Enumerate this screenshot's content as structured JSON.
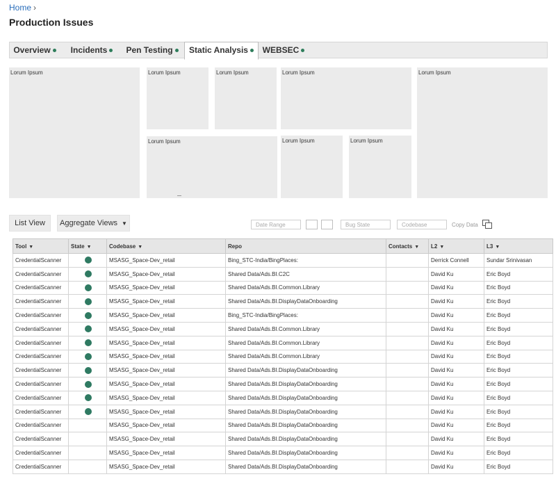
{
  "breadcrumb": {
    "home": "Home",
    "separator": "›"
  },
  "page": {
    "title": "Production Issues"
  },
  "tabs": [
    {
      "label": "Overview",
      "dot": true
    },
    {
      "label": "Incidents",
      "dot": true
    },
    {
      "label": "Pen Testing",
      "dot": true
    },
    {
      "label": "Static Analysis",
      "dot": true,
      "active": true
    },
    {
      "label": "WEBSEC",
      "dot": true
    }
  ],
  "panels": {
    "placeholder": "Lorum Ipsum"
  },
  "toolbar": {
    "list_view": "List View",
    "aggregate_views": "Aggregate Views",
    "date_range_placeholder": "Date Range",
    "bug_state_placeholder": "Bug State",
    "codebase_placeholder": "Codebase",
    "copy_data": "Copy Data"
  },
  "table": {
    "headers": [
      "Tool",
      "State",
      "Codebase",
      "Repo",
      "Contacts",
      "L2",
      "L3"
    ],
    "rows": [
      {
        "tool": "CredentialScanner",
        "state": true,
        "codebase": "MSASG_Space-Dev_retail",
        "repo": "Bing_STC-India/BingPlaces:",
        "contacts": "",
        "l2": "Derrick Connell",
        "l3": "Sundar Srinivasan"
      },
      {
        "tool": "CredentialScanner",
        "state": true,
        "codebase": "MSASG_Space-Dev_retail",
        "repo": "Shared Data/Ads.BI.C2C",
        "contacts": "",
        "l2": "David Ku",
        "l3": "Eric Boyd"
      },
      {
        "tool": "CredentialScanner",
        "state": true,
        "codebase": "MSASG_Space-Dev_retail",
        "repo": "Shared Data/Ads.BI.Common.Library",
        "contacts": "",
        "l2": "David Ku",
        "l3": "Eric Boyd"
      },
      {
        "tool": "CredentialScanner",
        "state": true,
        "codebase": "MSASG_Space-Dev_retail",
        "repo": "Shared Data/Ads.BI.DisplayDataOnboarding",
        "contacts": "",
        "l2": "David Ku",
        "l3": "Eric Boyd"
      },
      {
        "tool": "CredentialScanner",
        "state": true,
        "codebase": "MSASG_Space-Dev_retail",
        "repo": "Bing_STC-India/BingPlaces:",
        "contacts": "",
        "l2": "David Ku",
        "l3": "Eric Boyd"
      },
      {
        "tool": "CredentialScanner",
        "state": true,
        "codebase": "MSASG_Space-Dev_retail",
        "repo": "Shared Data/Ads.BI.Common.Library",
        "contacts": "",
        "l2": "David Ku",
        "l3": "Eric Boyd"
      },
      {
        "tool": "CredentialScanner",
        "state": true,
        "codebase": "MSASG_Space-Dev_retail",
        "repo": "Shared Data/Ads.BI.Common.Library",
        "contacts": "",
        "l2": "David Ku",
        "l3": "Eric Boyd"
      },
      {
        "tool": "CredentialScanner",
        "state": true,
        "codebase": "MSASG_Space-Dev_retail",
        "repo": "Shared Data/Ads.BI.Common.Library",
        "contacts": "",
        "l2": "David Ku",
        "l3": "Eric Boyd"
      },
      {
        "tool": "CredentialScanner",
        "state": true,
        "codebase": "MSASG_Space-Dev_retail",
        "repo": "Shared Data/Ads.BI.DisplayDataOnboarding",
        "contacts": "",
        "l2": "David Ku",
        "l3": "Eric Boyd"
      },
      {
        "tool": "CredentialScanner",
        "state": true,
        "codebase": "MSASG_Space-Dev_retail",
        "repo": "Shared Data/Ads.BI.DisplayDataOnboarding",
        "contacts": "",
        "l2": "David Ku",
        "l3": "Eric Boyd"
      },
      {
        "tool": "CredentialScanner",
        "state": true,
        "codebase": "MSASG_Space-Dev_retail",
        "repo": "Shared Data/Ads.BI.DisplayDataOnboarding",
        "contacts": "",
        "l2": "David Ku",
        "l3": "Eric Boyd"
      },
      {
        "tool": "CredentialScanner",
        "state": true,
        "codebase": "MSASG_Space-Dev_retail",
        "repo": "Shared Data/Ads.BI.DisplayDataOnboarding",
        "contacts": "",
        "l2": "David Ku",
        "l3": "Eric Boyd"
      },
      {
        "tool": "CredentialScanner",
        "state": false,
        "codebase": "MSASG_Space-Dev_retail",
        "repo": "Shared Data/Ads.BI.DisplayDataOnboarding",
        "contacts": "",
        "l2": "David Ku",
        "l3": "Eric Boyd"
      },
      {
        "tool": "CredentialScanner",
        "state": false,
        "codebase": "MSASG_Space-Dev_retail",
        "repo": "Shared Data/Ads.BI.DisplayDataOnboarding",
        "contacts": "",
        "l2": "David Ku",
        "l3": "Eric Boyd"
      },
      {
        "tool": "CredentialScanner",
        "state": false,
        "codebase": "MSASG_Space-Dev_retail",
        "repo": "Shared Data/Ads.BI.DisplayDataOnboarding",
        "contacts": "",
        "l2": "David Ku",
        "l3": "Eric Boyd"
      },
      {
        "tool": "CredentialScanner",
        "state": false,
        "codebase": "MSASG_Space-Dev_retail",
        "repo": "Shared Data/Ads.BI.DisplayDataOnboarding",
        "contacts": "",
        "l2": "David Ku",
        "l3": "Eric Boyd"
      }
    ]
  },
  "colors": {
    "accent_dot": "#2e7d5b",
    "link": "#2a6ebb",
    "panel_bg": "#ebebeb"
  }
}
